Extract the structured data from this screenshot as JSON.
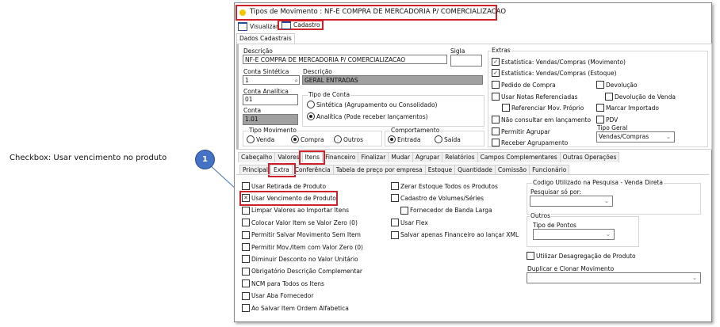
{
  "callout": {
    "label": "Checkbox: Usar vencimento no produto",
    "number": "1",
    "color": "#4472c4"
  },
  "title": "Tipos de Movimento  : NF-E COMPRA DE MERCADORIA P/ COMERCIALIZACAO",
  "toolbar": {
    "visualizar": "Visualizar",
    "cadastro": "Cadastro"
  },
  "page_tab": "Dados Cadastrais",
  "form": {
    "descricao_label": "Descrição",
    "descricao": "NF-E COMPRA DE MERCADORIA P/ COMERCIALIZACAO",
    "sigla_label": "Sigla",
    "sigla": "",
    "conta_sintetica_label": "Conta Sintética",
    "conta_sintetica": "1",
    "descricao2_label": "Descrição",
    "descricao2": "GERAL ENTRADAS",
    "conta_analitica_label": "Conta Analítica",
    "conta_analitica": "01",
    "conta_label": "Conta",
    "conta": "1.01",
    "tipo_conta": {
      "label": "Tipo de Conta",
      "sintetica": "Sintética (Agrupamento ou Consolidado)",
      "analitica": "Analítica (Pode receber lançamentos)"
    },
    "tipo_movimento": {
      "label": "Tipo Movimento",
      "venda": "Venda",
      "compra": "Compra",
      "outros": "Outros"
    },
    "comportamento": {
      "label": "Comportamento",
      "entrada": "Entrada",
      "saida": "Saída"
    }
  },
  "extras": {
    "label": "Extras",
    "est_mov": "Estatística: Vendas/Compras (Movimento)",
    "est_est": "Estatística: Vendas/Compras (Estoque)",
    "pedido": "Pedido de Compra",
    "devolucao": "Devolução",
    "usar_notas": "Usar Notas Referenciadas",
    "dev_venda": "Devolução de Venda",
    "ref_mov": "Referenciar Mov. Próprio",
    "marcar": "Marcar Importado",
    "nao_consultar": "Não consultar em lançamento",
    "pdv": "PDV",
    "permitir": "Permitir Agrupar",
    "receber": "Receber Agrupamento",
    "tipo_geral_label": "Tipo Geral",
    "tipo_geral": "Vendas/Compras"
  },
  "tabs": [
    "Cabeçalho",
    "Valores",
    "Itens",
    "Financeiro",
    "Finalizar",
    "Mudar",
    "Agrupar",
    "Relatórios",
    "Campos Complementares",
    "Outras Operações"
  ],
  "subtabs": [
    "Principal",
    "Extra",
    "Conferência",
    "Tabela de preço por empresa",
    "Estoque",
    "Quantidade",
    "Comissão",
    "Funcionário"
  ],
  "left_checks": [
    "Usar Retirada de Produto",
    "Usar Vencimento de Produto",
    "Limpar Valores ao Importar Itens",
    "Colocar Valor Item se Valor Zero (0)",
    "Permitir Salvar Movimento Sem Item",
    "Permitir Mov./Item com Valor Zero (0)",
    "Diminuir Desconto no Valor Unitário",
    "Obrigatório Descrição Complementar",
    "NCM para Todos os Itens",
    "Usar Aba Fornecedor",
    "Ao Salvar Item Ordem Alfabetica"
  ],
  "mid_checks": [
    "Zerar Estoque Todos os Produtos",
    "Cadastro de Volumes/Séries",
    "Fornecedor de Banda Larga",
    "Usar Flex",
    "Salvar apenas Financeiro ao lançar XML"
  ],
  "right": {
    "codigo_group": "Codigo Utilizado na Pesquisa - Venda Direta",
    "pesquisar_label": "Pesquisar só por:",
    "pesquisar": "",
    "outros_group": "Outros",
    "tipo_pontos_label": "Tipo de Pontos",
    "tipo_pontos": "",
    "desagregacao": "Utilizar Desagregação de Produto",
    "duplicar_label": "Duplicar e Clonar Movimento",
    "duplicar": ""
  }
}
